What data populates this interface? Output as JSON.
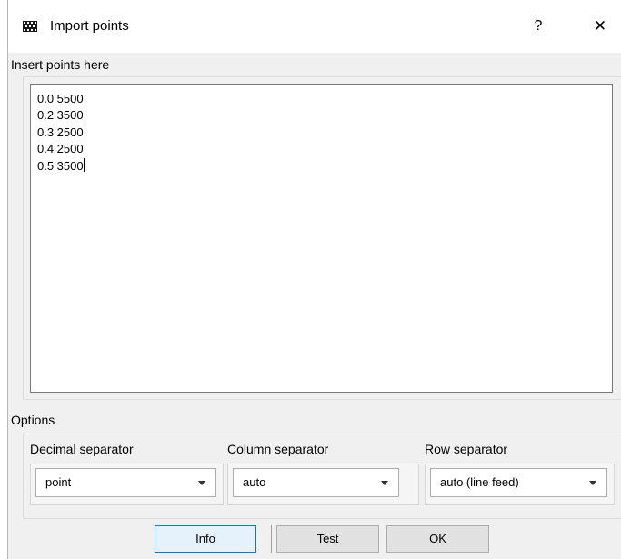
{
  "window": {
    "title": "Import points",
    "help_glyph": "?",
    "close_glyph": "✕",
    "app_icon": "grid-app-icon"
  },
  "input": {
    "label": "Insert points here",
    "lines": [
      "0.0 5500",
      "0.2 3500",
      "0.3 2500",
      "0.4 2500",
      "0.5 3500"
    ]
  },
  "options": {
    "label": "Options",
    "decimal": {
      "label": "Decimal separator",
      "value": "point"
    },
    "column": {
      "label": "Column separator",
      "value": "auto"
    },
    "row": {
      "label": "Row separator",
      "value": "auto (line feed)"
    }
  },
  "buttons": {
    "info": "Info",
    "test": "Test",
    "ok": "OK"
  }
}
